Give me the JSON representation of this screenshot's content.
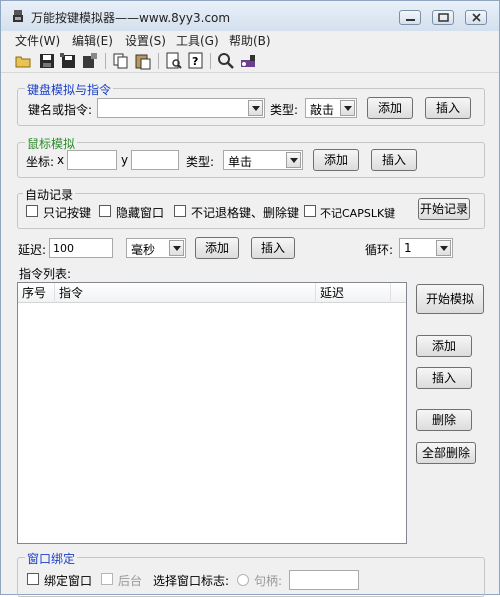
{
  "window": {
    "title": "万能按键模拟器——www.8yy3.com"
  },
  "menu": [
    "文件(W)",
    "编辑(E)",
    "设置(S)",
    "工具(G)",
    "帮助(B)"
  ],
  "toolbar_icons": [
    "open-folder-icon",
    "save-icon",
    "save-all-icon",
    "properties-icon",
    "copy-icon",
    "paste-icon",
    "print-preview-icon",
    "help-icon",
    "search-icon",
    "run-icon"
  ],
  "keyboard": {
    "legend": "键盘模拟与指令",
    "key_label": "键名或指令:",
    "key_value": "",
    "type_label": "类型:",
    "type_value": "敲击",
    "add": "添加",
    "insert": "插入"
  },
  "mouse": {
    "legend": "鼠标模拟",
    "coord_label": "坐标:",
    "x_label": "x",
    "x_value": "",
    "y_label": "y",
    "y_value": "",
    "type_label": "类型:",
    "type_value": "单击",
    "add": "添加",
    "insert": "插入"
  },
  "auto_record": {
    "legend": "自动记录",
    "options": [
      "只记按键",
      "隐藏窗口",
      "不记退格键、删除键",
      "不记CAPSLK键"
    ],
    "start": "开始记录"
  },
  "delay": {
    "label": "延迟:",
    "value": "100",
    "unit": "毫秒",
    "add": "添加",
    "insert": "插入",
    "loop_label": "循环:",
    "loop_value": "1"
  },
  "commands": {
    "label": "指令列表:",
    "columns": [
      "序号",
      "指令",
      "延迟"
    ],
    "rows": []
  },
  "side_buttons": {
    "start": "开始模拟",
    "add": "添加",
    "insert": "插入",
    "delete": "删除",
    "delete_all": "全部删除"
  },
  "window_bind": {
    "legend": "窗口绑定",
    "bind_label": "绑定窗口",
    "backstage_label": "后台",
    "select_label": "选择窗口标志:",
    "handle_label": "句柄:",
    "handle_value": ""
  }
}
